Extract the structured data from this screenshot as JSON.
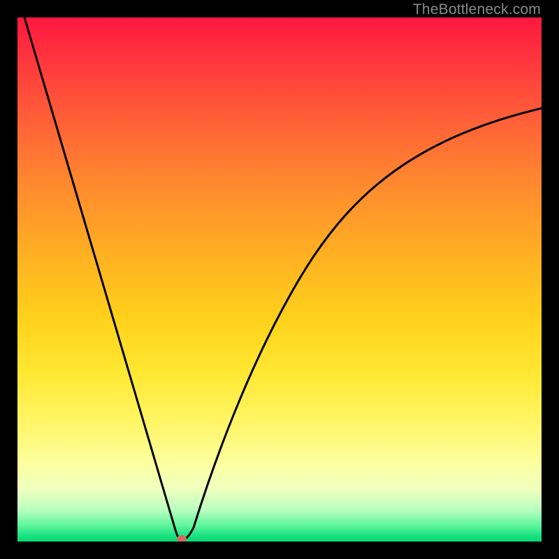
{
  "watermark": "TheBottleneck.com",
  "chart_data": {
    "type": "line",
    "title": "",
    "xlabel": "",
    "ylabel": "",
    "xlim": [
      0,
      100
    ],
    "ylim": [
      0,
      100
    ],
    "grid": false,
    "legend": false,
    "background_gradient": {
      "direction": "vertical",
      "stops": [
        {
          "pos": 0,
          "color": "#ff173e"
        },
        {
          "pos": 32,
          "color": "#ff8a2e"
        },
        {
          "pos": 58,
          "color": "#ffd21b"
        },
        {
          "pos": 85,
          "color": "#fcff9f"
        },
        {
          "pos": 100,
          "color": "#0bd876"
        }
      ]
    },
    "series": [
      {
        "name": "bottleneck-curve",
        "color": "#000000",
        "x": [
          0,
          5,
          10,
          15,
          20,
          25,
          28,
          30,
          31,
          32,
          34,
          36,
          40,
          45,
          50,
          55,
          60,
          70,
          80,
          90,
          100
        ],
        "values": [
          100,
          84,
          68,
          52,
          36,
          18,
          7,
          1,
          0,
          1,
          6,
          13,
          27,
          40,
          50,
          58,
          64,
          72,
          77,
          80,
          82
        ]
      }
    ],
    "marker": {
      "name": "min-point",
      "x": 31,
      "y": 0,
      "color": "#d06a5c"
    }
  }
}
